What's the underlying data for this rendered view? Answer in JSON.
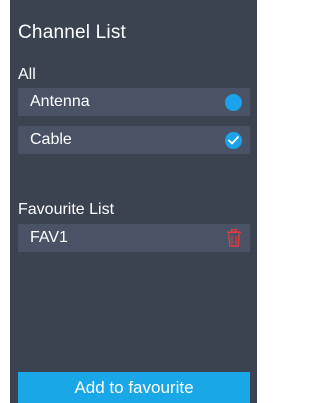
{
  "title": "Channel List",
  "channel_section": {
    "label": "All",
    "items": [
      {
        "label": "Antenna",
        "state": "selected",
        "icon": "radio-filled-icon"
      },
      {
        "label": "Cable",
        "state": "checked",
        "icon": "check-circle-icon"
      }
    ]
  },
  "favourite_section": {
    "label": "Favourite List",
    "items": [
      {
        "label": "FAV1",
        "icon": "trash-icon"
      }
    ]
  },
  "add_button": {
    "label": "Add to favourite"
  },
  "colors": {
    "panel_bg": "#3b4351",
    "row_bg": "#4a5366",
    "accent": "#1aa3ea",
    "delete": "#e23b3b"
  }
}
